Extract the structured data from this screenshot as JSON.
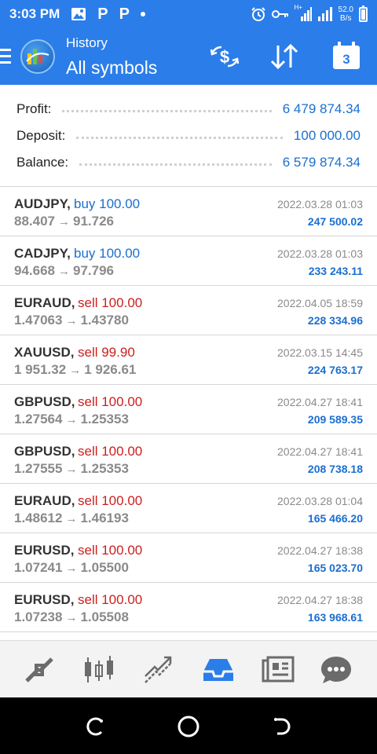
{
  "status_bar": {
    "time": "3:03 PM",
    "speed_value": "52.0",
    "speed_unit": "B/s",
    "icons": [
      "image-icon",
      "p-app-icon",
      "p-app-icon",
      "notification-dot-icon",
      "alarm-icon",
      "key-icon",
      "signal-icon",
      "signal-icon",
      "battery-icon"
    ],
    "p_glyph": "P",
    "network_label": "H+"
  },
  "header": {
    "subtitle": "History",
    "title": "All symbols",
    "calendar_day": "3",
    "actions": [
      "currency-exchange-icon",
      "sort-icon",
      "calendar-icon"
    ]
  },
  "summary": {
    "profit_label": "Profit:",
    "profit_value": "6 479 874.34",
    "deposit_label": "Deposit:",
    "deposit_value": "100 000.00",
    "balance_label": "Balance:",
    "balance_value": "6 579 874.34"
  },
  "deals": [
    {
      "symbol": "AUDJPY,",
      "side": "buy 100.00",
      "type": "buy",
      "open": "88.407",
      "close": "91.726",
      "time": "2022.03.28 01:03",
      "profit": "247 500.02"
    },
    {
      "symbol": "CADJPY,",
      "side": "buy 100.00",
      "type": "buy",
      "open": "94.668",
      "close": "97.796",
      "time": "2022.03.28 01:03",
      "profit": "233 243.11"
    },
    {
      "symbol": "EURAUD,",
      "side": "sell 100.00",
      "type": "sell",
      "open": "1.47063",
      "close": "1.43780",
      "time": "2022.04.05 18:59",
      "profit": "228 334.96"
    },
    {
      "symbol": "XAUUSD,",
      "side": "sell 99.90",
      "type": "sell",
      "open": "1 951.32",
      "close": "1 926.61",
      "time": "2022.03.15 14:45",
      "profit": "224 763.17"
    },
    {
      "symbol": "GBPUSD,",
      "side": "sell 100.00",
      "type": "sell",
      "open": "1.27564",
      "close": "1.25353",
      "time": "2022.04.27 18:41",
      "profit": "209 589.35"
    },
    {
      "symbol": "GBPUSD,",
      "side": "sell 100.00",
      "type": "sell",
      "open": "1.27555",
      "close": "1.25353",
      "time": "2022.04.27 18:41",
      "profit": "208 738.18"
    },
    {
      "symbol": "EURAUD,",
      "side": "sell 100.00",
      "type": "sell",
      "open": "1.48612",
      "close": "1.46193",
      "time": "2022.03.28 01:04",
      "profit": "165 466.20"
    },
    {
      "symbol": "EURUSD,",
      "side": "sell 100.00",
      "type": "sell",
      "open": "1.07241",
      "close": "1.05500",
      "time": "2022.04.27 18:38",
      "profit": "165 023.70"
    },
    {
      "symbol": "EURUSD,",
      "side": "sell 100.00",
      "type": "sell",
      "open": "1.07238",
      "close": "1.05508",
      "time": "2022.04.27 18:38",
      "profit": "163 968.61"
    }
  ],
  "price_arrow": "→",
  "bottom_nav": {
    "items": [
      "quotes-icon",
      "chart-icon",
      "trade-icon",
      "history-icon",
      "news-icon",
      "chat-icon"
    ],
    "active": "history-icon"
  },
  "system_nav": [
    "recents-icon",
    "home-icon",
    "back-icon"
  ],
  "colors": {
    "primary": "#2b7de9",
    "value_blue": "#1a6fd0",
    "buy": "#1a6fd0",
    "sell": "#cc1f1f",
    "muted": "#8a8a8a",
    "icon_gray": "#6b6b6b"
  }
}
